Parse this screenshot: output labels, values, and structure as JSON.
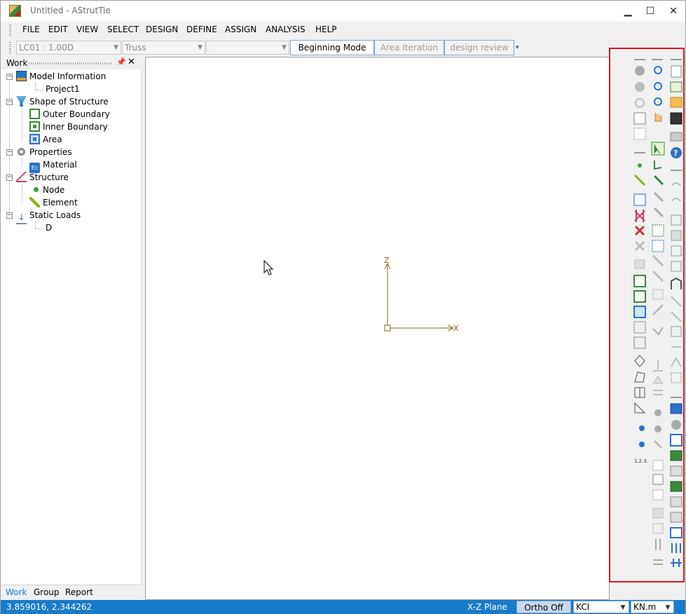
{
  "window": {
    "title": "Untitled -  AStrutTie",
    "minimize": "▁",
    "maximize": "☐",
    "close": "✕"
  },
  "menu": [
    "FILE",
    "EDIT",
    "VIEW",
    "SELECT",
    "DESIGN",
    "DEFINE",
    "ASSIGN",
    "ANALYSIS",
    "HELP"
  ],
  "toolbar": {
    "load_case": "LC01 : 1.00D",
    "model_type": "Truss",
    "third_combo": "",
    "modes": [
      "Beginning Mode",
      "Area Iteration",
      "design review"
    ]
  },
  "panel": {
    "title": "Work",
    "pin": "📌",
    "close": "✕",
    "tree": [
      {
        "label": "Model Information",
        "icon": "monitor-icon"
      },
      {
        "label": "Project1",
        "icon": ""
      },
      {
        "label": "Shape of Structure",
        "icon": "funnel-icon"
      },
      {
        "label": "Outer Boundary",
        "icon": "outer-boundary-icon"
      },
      {
        "label": "Inner Boundary",
        "icon": "inner-boundary-icon"
      },
      {
        "label": "Area",
        "icon": "area-icon"
      },
      {
        "label": "Properties",
        "icon": "gears-icon"
      },
      {
        "label": "Material",
        "icon": "material-icon"
      },
      {
        "label": "Structure",
        "icon": "truss-icon"
      },
      {
        "label": "Node",
        "icon": "node-dot-icon"
      },
      {
        "label": "Element",
        "icon": "element-line-icon"
      },
      {
        "label": "Static Loads",
        "icon": "load-arrow-icon"
      },
      {
        "label": "D",
        "icon": ""
      }
    ],
    "tabs": [
      "Work",
      "Group",
      "Report"
    ]
  },
  "canvas": {
    "axis_z": "Z",
    "axis_x": "X"
  },
  "status": {
    "coords": "3.859016, 2.344262",
    "plane": "X-Z Plane",
    "ortho": "Ortho Off",
    "code": "KCI",
    "unit": "KN.m"
  },
  "colors": {
    "accent": "#1a7bc8",
    "highlight_box": "#e0141e",
    "axis": "#8a6a10"
  }
}
